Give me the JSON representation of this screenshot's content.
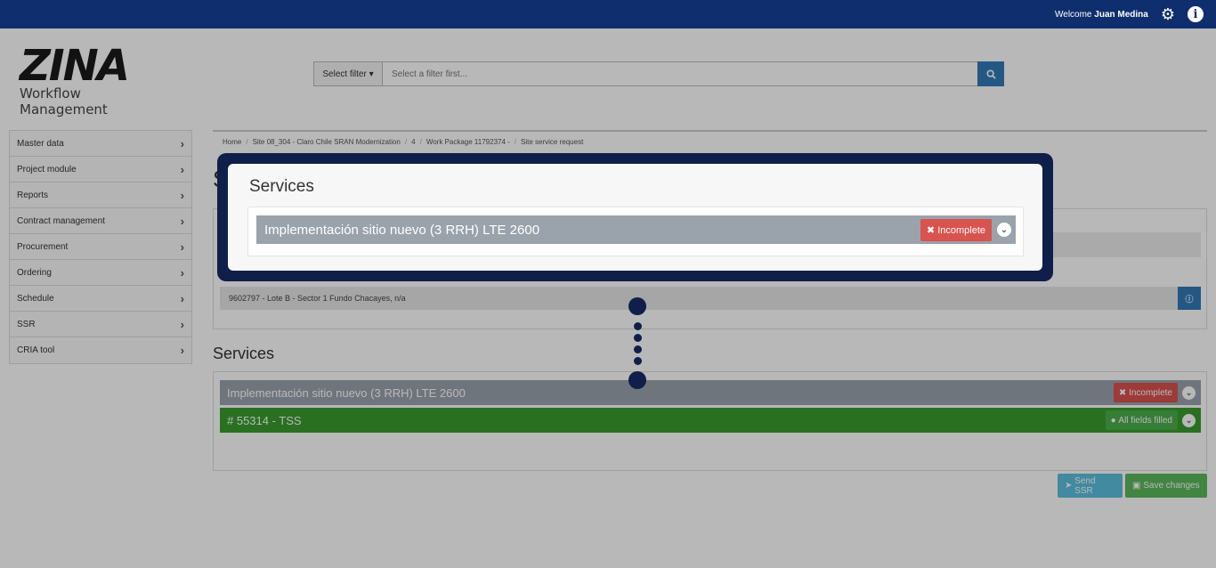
{
  "topbar": {
    "welcome_prefix": "Welcome",
    "user_name": "Juan Medina",
    "settings_icon": "gear-icon",
    "info_icon": "info-icon"
  },
  "logo": {
    "word": "ZINA",
    "subtitle": "Workflow Management"
  },
  "search": {
    "filter_label": "Select filter ▾",
    "placeholder": "Select a filter first...",
    "button_icon": "search-icon"
  },
  "sidebar": {
    "items": [
      {
        "label": "Master data"
      },
      {
        "label": "Project module"
      },
      {
        "label": "Reports"
      },
      {
        "label": "Contract management"
      },
      {
        "label": "Procurement"
      },
      {
        "label": "Ordering"
      },
      {
        "label": "Schedule"
      },
      {
        "label": "SSR"
      },
      {
        "label": "CRIA tool"
      }
    ]
  },
  "breadcrumb": {
    "items": [
      "Home",
      "Site 08_304 - Claro Chile SRAN Modernization",
      "4",
      "Work Package 11792374 -",
      "Site service request"
    ]
  },
  "page": {
    "title_fragment": "S"
  },
  "site": {
    "address": "9602797 - Lote B - Sector 1 Fundo Chacayes, n/a"
  },
  "services": {
    "title": "Services",
    "rows": [
      {
        "label": "Implementación sitio nuevo (3 RRH) LTE 2600",
        "status": "Incomplete",
        "status_icon": "✖"
      },
      {
        "label": "# 55314 - TSS",
        "status": "All fields filled",
        "status_icon": "●"
      }
    ]
  },
  "actions": {
    "send": "Send SSR",
    "save": "Save changes"
  },
  "callout": {
    "title": "Services",
    "row_label": "Implementación sitio nuevo (3 RRH) LTE 2600",
    "status": "Incomplete",
    "status_icon": "✖"
  }
}
